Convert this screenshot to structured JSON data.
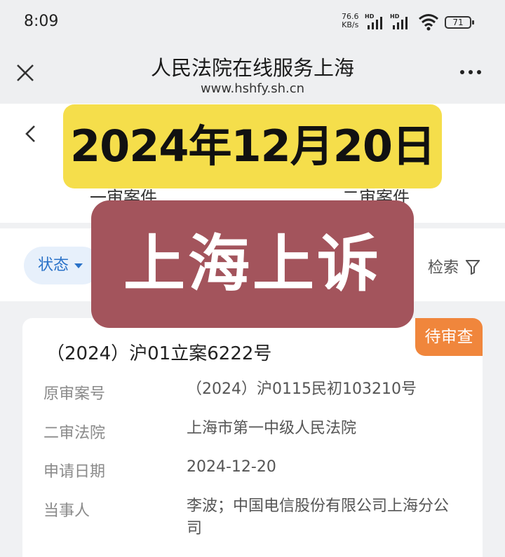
{
  "status_bar": {
    "time": "8:09",
    "net_speed_value": "76.6",
    "net_speed_unit": "KB/s",
    "signal_label": "HD",
    "battery": "71"
  },
  "header": {
    "title": "人民法院在线服务上海",
    "url": "www.hshfy.sh.cn",
    "close_icon": "close-icon",
    "more_icon": "more-icon"
  },
  "tabs": [
    {
      "label": "一审案件"
    },
    {
      "label": "二审案件"
    }
  ],
  "filters": {
    "status_label": "状态",
    "search_label": "检索"
  },
  "overlay": {
    "date": "2024年12月20日",
    "topic": "上海上诉"
  },
  "case": {
    "status_badge": "待审查",
    "number": "（2024）沪01立案6222号",
    "fields": [
      {
        "label": "原审案号",
        "value": "（2024）沪0115民初103210号"
      },
      {
        "label": "二审法院",
        "value": "上海市第一中级人民法院"
      },
      {
        "label": "申请日期",
        "value": "2024-12-20"
      },
      {
        "label": "当事人",
        "value": "李波；中国电信股份有限公司上海分公司"
      }
    ]
  },
  "colors": {
    "accent_blue": "#2a72c8",
    "badge_orange": "#f0863c",
    "banner_yellow": "#f5de4b",
    "banner_red": "#a3545c"
  }
}
